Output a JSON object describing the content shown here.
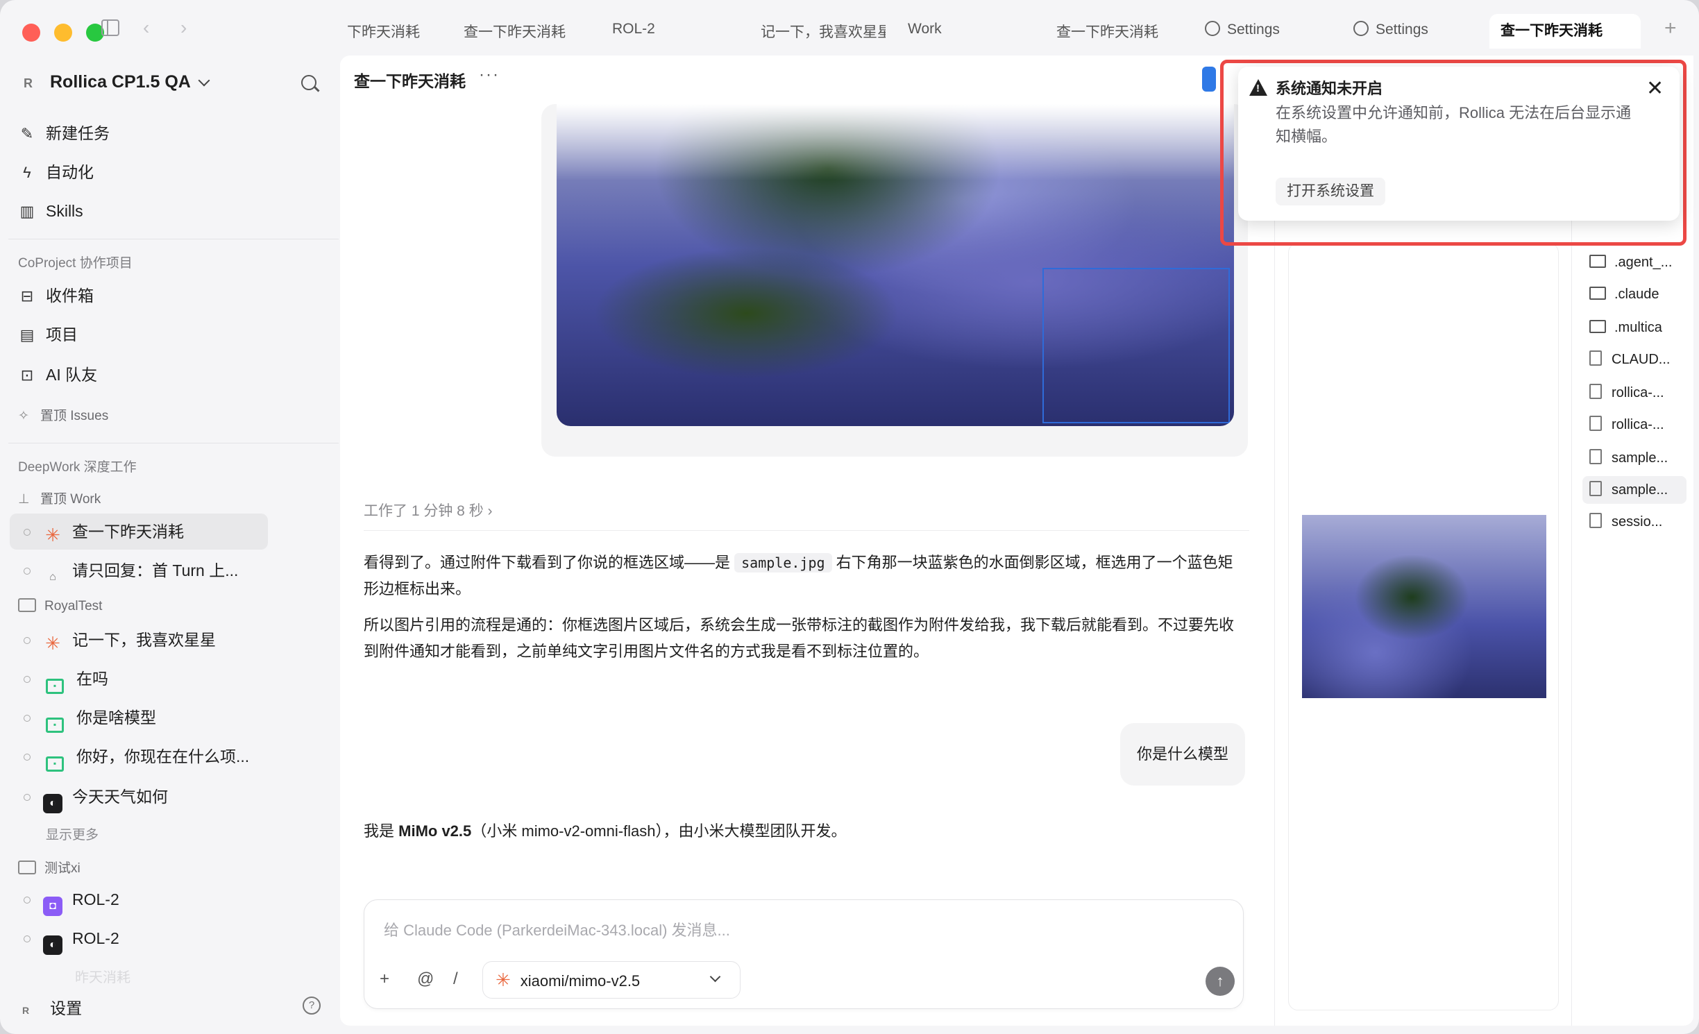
{
  "tabs": [
    {
      "label": "下昨天消耗"
    },
    {
      "label": "查一下昨天消耗"
    },
    {
      "label": "ROL-2"
    },
    {
      "label": "记一下，我喜欢星星"
    },
    {
      "label": "Work"
    },
    {
      "label": "查一下昨天消耗"
    },
    {
      "label": "Settings"
    },
    {
      "label": "Settings"
    },
    {
      "label": "查一下昨天消耗"
    }
  ],
  "workspace": {
    "badge": "R",
    "name": "Rollica CP1.5 QA"
  },
  "nav": [
    {
      "label": "新建任务",
      "icon": "edit-icon"
    },
    {
      "label": "自动化",
      "icon": "bolt-icon"
    },
    {
      "label": "Skills",
      "icon": "book-icon"
    }
  ],
  "coproject": {
    "title": "CoProject 协作项目",
    "items": [
      {
        "label": "收件箱",
        "icon": "inbox-icon"
      },
      {
        "label": "项目",
        "icon": "project-icon"
      },
      {
        "label": "AI 队友",
        "icon": "robot-icon"
      }
    ],
    "pinned": "置顶 Issues"
  },
  "deepwork": {
    "title": "DeepWork 深度工作",
    "pinned": "置顶 Work",
    "tasks": [
      {
        "label": "查一下昨天消耗"
      },
      {
        "label": "请只回复：首 Turn 上..."
      }
    ]
  },
  "royaltest": {
    "label": "RoyalTest",
    "tasks": [
      {
        "label": "记一下，我喜欢星星"
      },
      {
        "label": "在吗"
      },
      {
        "label": "你是啥模型"
      },
      {
        "label": "你好，你现在在什么项..."
      },
      {
        "label": "今天天气如何"
      }
    ],
    "show_more": "显示更多"
  },
  "testxi": {
    "label": "测试xi",
    "tasks": [
      {
        "label": "ROL-2"
      },
      {
        "label": "ROL-2"
      }
    ],
    "faded": "昨天消耗"
  },
  "footer": {
    "badge": "R",
    "settings": "设置"
  },
  "main": {
    "title": "查一下昨天消耗",
    "worked": "工作了 1 分钟 8 秒",
    "para1_a": "看得到了。通过附件下载看到了你说的框选区域——是 ",
    "para1_code": "sample.jpg",
    "para1_b": " 右下角那一块蓝紫色的水面倒影区域，框选用了一个蓝色矩形边框标出来。",
    "para2": "所以图片引用的流程是通的：你框选图片区域后，系统会生成一张带标注的截图作为附件发给我，我下载后就能看到。不过要先收到附件通知才能看到，之前单纯文字引用图片文件名的方式我是看不到标注位置的。",
    "user_msg": "你是什么模型",
    "reply_a": "我是 ",
    "reply_bold": "MiMo v2.5",
    "reply_b": "（小米 mimo-v2-omni-flash），由小米大模型团队开发。"
  },
  "composer": {
    "placeholder": "给 Claude Code (ParkerdeiMac-343.local) 发消息...",
    "model": "xiaomi/mimo-v2.5",
    "plus": "+",
    "at": "@",
    "slash": "/"
  },
  "files": [
    {
      "name": ".agent_...",
      "type": "folder"
    },
    {
      "name": ".claude",
      "type": "folder"
    },
    {
      "name": ".multica",
      "type": "folder"
    },
    {
      "name": "CLAUD...",
      "type": "file"
    },
    {
      "name": "rollica-...",
      "type": "file"
    },
    {
      "name": "rollica-...",
      "type": "file"
    },
    {
      "name": "sample...",
      "type": "image"
    },
    {
      "name": "sample...",
      "type": "image"
    },
    {
      "name": "sessio...",
      "type": "file"
    }
  ],
  "notification": {
    "title": "系统通知未开启",
    "body": "在系统设置中允许通知前，Rollica 无法在后台显示通知横幅。",
    "button": "打开系统设置"
  }
}
